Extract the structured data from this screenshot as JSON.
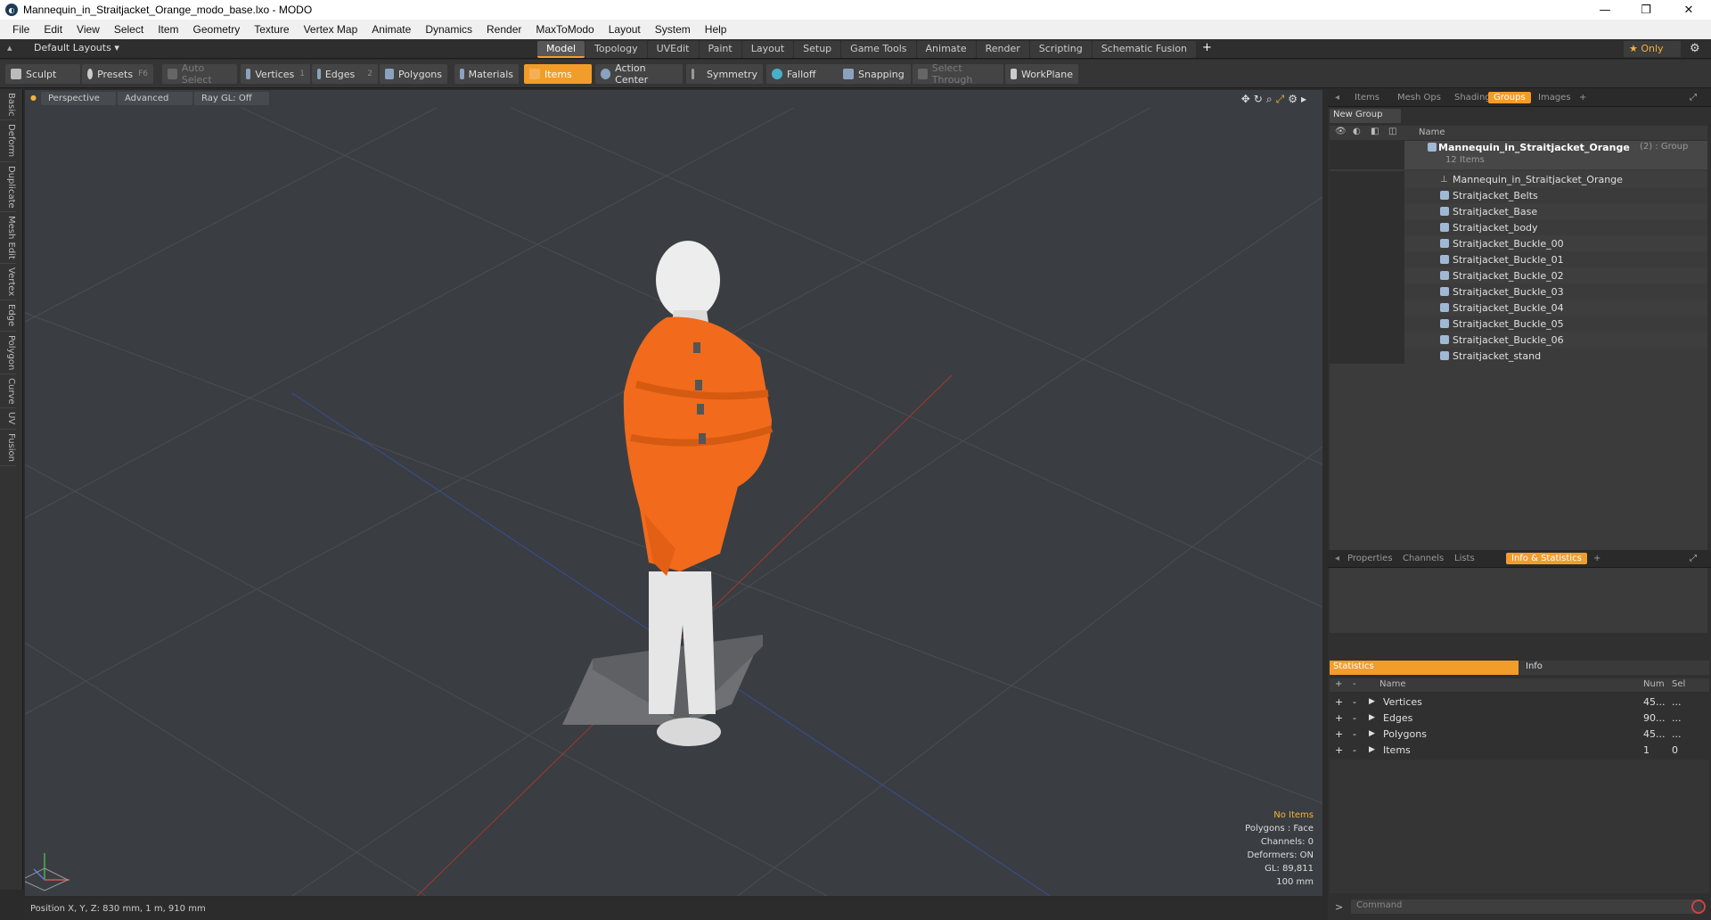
{
  "window": {
    "title": "Mannequin_in_Straitjacket_Orange_modo_base.lxo - MODO"
  },
  "menu": [
    "File",
    "Edit",
    "View",
    "Select",
    "Item",
    "Geometry",
    "Texture",
    "Vertex Map",
    "Animate",
    "Dynamics",
    "Render",
    "MaxToModo",
    "Layout",
    "System",
    "Help"
  ],
  "layout": {
    "name": "Default Layouts",
    "only_label": "Only"
  },
  "tabs": [
    "Model",
    "Topology",
    "UVEdit",
    "Paint",
    "Layout",
    "Setup",
    "Game Tools",
    "Animate",
    "Render",
    "Scripting",
    "Schematic Fusion"
  ],
  "tabs_active": "Model",
  "toolbar": {
    "sculpt": "Sculpt",
    "presets": "Presets",
    "presets_key": "F6",
    "auto_select": "Auto Select",
    "vertices": "Vertices",
    "vertices_key": "1",
    "edges": "Edges",
    "edges_key": "2",
    "polygons": "Polygons",
    "materials": "Materials",
    "items": "Items",
    "action_center": "Action Center",
    "symmetry": "Symmetry",
    "falloff": "Falloff",
    "snapping": "Snapping",
    "select_through": "Select Through",
    "workplane": "WorkPlane"
  },
  "left_tabs": [
    "Basic",
    "Deform",
    "Duplicate",
    "Mesh Edit",
    "Vertex",
    "Edge",
    "Polygon",
    "Curve",
    "UV",
    "Fusion"
  ],
  "viewport": {
    "view": "Perspective",
    "shading": "Advanced",
    "raygl": "Ray GL: Off",
    "info": {
      "no_items": "No Items",
      "polygons": "Polygons : Face",
      "channels": "Channels: 0",
      "deformers": "Deformers: ON",
      "gl": "GL: 89,811",
      "scale": "100 mm"
    }
  },
  "status": {
    "position": "Position X, Y, Z:  830 mm, 1 m, 910 mm"
  },
  "items_panel": {
    "tabs": [
      "Items",
      "Mesh Ops",
      "Shading",
      "Groups",
      "Images"
    ],
    "active": "Groups",
    "new_group": "New Group",
    "col_name": "Name",
    "group": {
      "name": "Mannequin_in_Straitjacket_Orange",
      "suffix": "(2) : Group",
      "count": "12 Items"
    },
    "children": [
      "Mannequin_in_Straitjacket_Orange",
      "Straitjacket_Belts",
      "Straitjacket_Base",
      "Straitjacket_body",
      "Straitjacket_Buckle_00",
      "Straitjacket_Buckle_01",
      "Straitjacket_Buckle_02",
      "Straitjacket_Buckle_03",
      "Straitjacket_Buckle_04",
      "Straitjacket_Buckle_05",
      "Straitjacket_Buckle_06",
      "Straitjacket_stand"
    ]
  },
  "info_panel": {
    "tabs": [
      "Properties",
      "Channels",
      "Lists",
      "Info & Statistics"
    ],
    "active": "Info & Statistics",
    "statistics": "Statistics",
    "info": "Info",
    "cols": {
      "name": "Name",
      "num": "Num",
      "sel": "Sel"
    },
    "rows": [
      {
        "name": "Vertices",
        "num": "45...",
        "sel": "..."
      },
      {
        "name": "Edges",
        "num": "90...",
        "sel": "..."
      },
      {
        "name": "Polygons",
        "num": "45...",
        "sel": "..."
      },
      {
        "name": "Items",
        "num": "1",
        "sel": "0"
      }
    ],
    "command_placeholder": "Command"
  },
  "colors": {
    "accent": "#f29d2a",
    "jacket": "#f26a1b",
    "mannequin": "#e8e8e8",
    "viewport_bg": "#3a3e42"
  }
}
